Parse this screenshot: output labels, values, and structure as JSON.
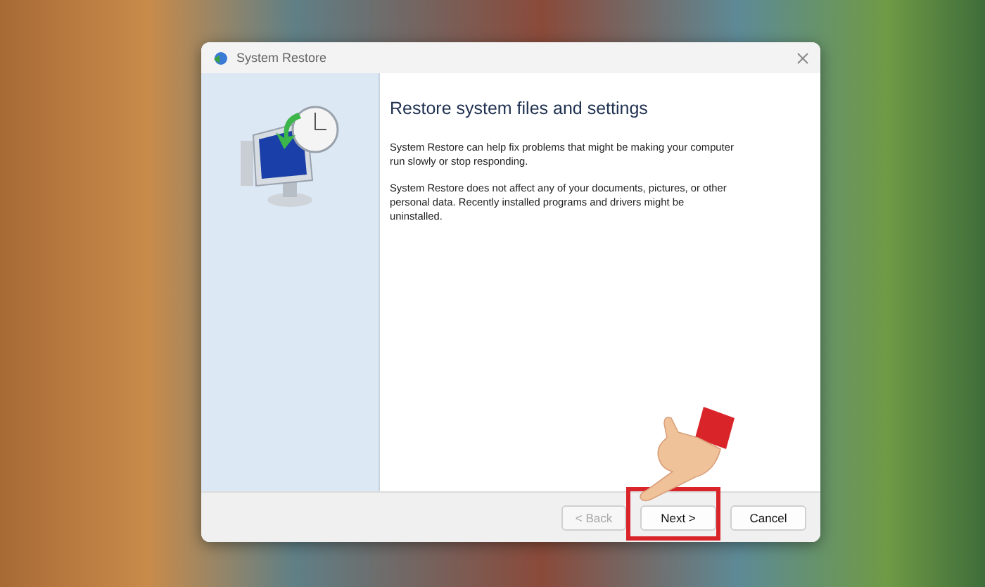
{
  "window": {
    "title": "System Restore"
  },
  "heading": "Restore system files and settings",
  "paragraphs": [
    "System Restore can help fix problems that might be making your computer run slowly or stop responding.",
    "System Restore does not affect any of your documents, pictures, or other personal data. Recently installed programs and drivers might be uninstalled."
  ],
  "buttons": [
    {
      "label": "< Back",
      "disabled": true,
      "highlighted": false
    },
    {
      "label": "Next >",
      "disabled": false,
      "highlighted": true
    },
    {
      "label": "Cancel",
      "disabled": false,
      "highlighted": false
    }
  ]
}
